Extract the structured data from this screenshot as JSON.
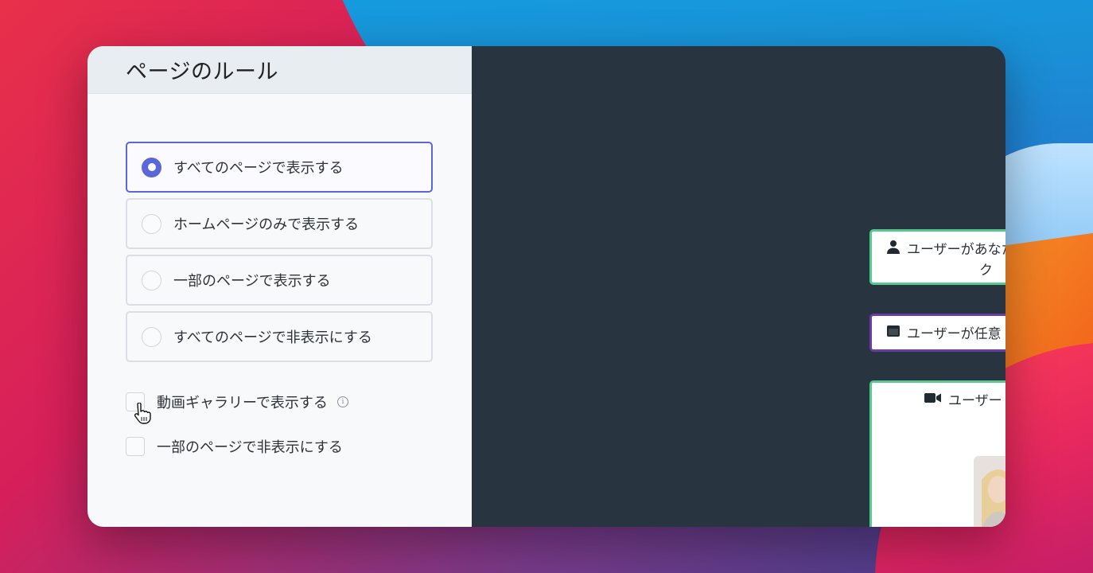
{
  "panel": {
    "title": "ページのルール"
  },
  "display_options": [
    {
      "label": "すべてのページで表示する",
      "selected": true
    },
    {
      "label": "ホームページのみで表示する",
      "selected": false
    },
    {
      "label": "一部のページで表示する",
      "selected": false
    },
    {
      "label": "すべてのページで非表示にする",
      "selected": false
    }
  ],
  "checkboxes": [
    {
      "label": "動画ギャラリーで表示する",
      "checked": false,
      "info_icon": "info-icon"
    },
    {
      "label": "一部のページで非表示にする",
      "checked": false
    }
  ],
  "flow": {
    "nodes": [
      {
        "icon": "user-icon",
        "text": "ユーザーがあなた",
        "subtext": "ク"
      },
      {
        "icon": "window-icon",
        "text": "ユーザーが任意"
      },
      {
        "icon": "video-camera-icon",
        "text": "ユーザー"
      }
    ]
  },
  "colors": {
    "accent": "#5a67d8",
    "canvas": "#283540",
    "node_green": "#58c98e",
    "node_purple": "#6a3aa5"
  }
}
